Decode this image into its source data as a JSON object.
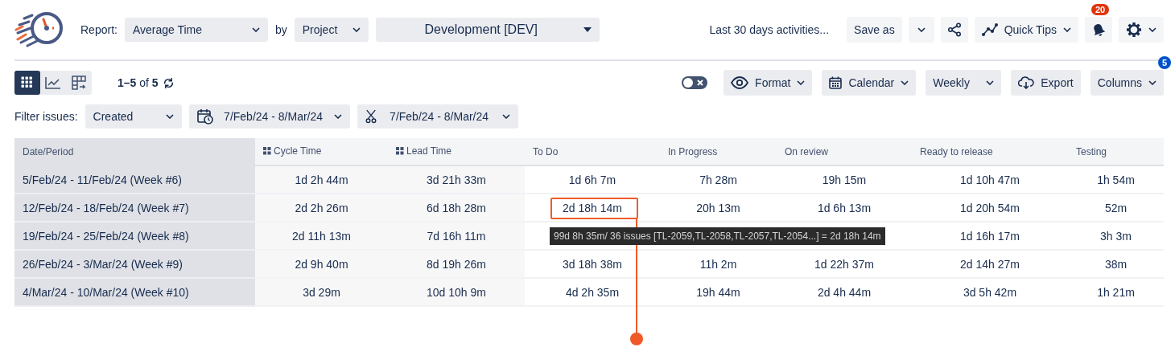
{
  "header": {
    "report_label": "Report:",
    "report": "Average Time",
    "by_label": "by",
    "group": "Project",
    "project": "Development [DEV]",
    "saved_filter": "Last 30 days activities...",
    "save_as": "Save as",
    "quick_tips": "Quick Tips",
    "notifications_count": "20"
  },
  "toolbar": {
    "views": [
      {
        "kind": "grid",
        "selected": true
      },
      {
        "kind": "chart",
        "selected": false
      },
      {
        "kind": "pivot",
        "selected": false
      }
    ],
    "pagination": "**1–5** of **5**",
    "toggle": {
      "on": false
    },
    "format": "Format",
    "calendar": "Calendar",
    "interval": "Weekly",
    "export": "Export",
    "columns": "Columns",
    "columns_count": "5"
  },
  "filters": {
    "label": "Filter issues:",
    "field": "Created",
    "date_range": "7/Feb/24 - 8/Mar/24",
    "resolved_range": "7/Feb/24 - 8/Mar/24"
  },
  "table": {
    "columns": [
      {
        "label": "Date/Period",
        "kind": "period"
      },
      {
        "label": "Cycle Time",
        "kind": "metric"
      },
      {
        "label": "Lead Time",
        "kind": "metric"
      },
      {
        "label": "To Do",
        "kind": "status"
      },
      {
        "label": "In Progress",
        "kind": "status"
      },
      {
        "label": "On review",
        "kind": "status"
      },
      {
        "label": "Ready to release",
        "kind": "status"
      },
      {
        "label": "Testing",
        "kind": "status"
      }
    ],
    "rows": [
      {
        "cells": [
          {
            "text": "5/Feb/24 - 11/Feb/24 (Week #6)",
            "highlighted": false
          },
          {
            "text": "1d 2h 44m",
            "highlighted": false
          },
          {
            "text": "3d 21h 33m",
            "highlighted": false
          },
          {
            "text": "1d 6h 7m",
            "highlighted": false
          },
          {
            "text": "7h 28m",
            "highlighted": false
          },
          {
            "text": "19h 15m",
            "highlighted": false
          },
          {
            "text": "1d 10h 47m",
            "highlighted": false
          },
          {
            "text": "1h 54m",
            "highlighted": false
          }
        ]
      },
      {
        "cells": [
          {
            "text": "12/Feb/24 - 18/Feb/24 (Week #7)",
            "highlighted": false
          },
          {
            "text": "2d 2h 26m",
            "highlighted": false
          },
          {
            "text": "6d 18h 28m",
            "highlighted": false
          },
          {
            "text": "2d 18h 14m",
            "highlighted": true
          },
          {
            "text": "20h 13m",
            "highlighted": false
          },
          {
            "text": "1d 6h 13m",
            "highlighted": false
          },
          {
            "text": "1d 20h 54m",
            "highlighted": false
          },
          {
            "text": "52m",
            "highlighted": false
          }
        ]
      },
      {
        "cells": [
          {
            "text": "19/Feb/24 - 25/Feb/24 (Week #8)",
            "highlighted": false
          },
          {
            "text": "2d 11h 13m",
            "highlighted": false
          },
          {
            "text": "7d 16h 11m",
            "highlighted": false
          },
          {
            "highlighted": false
          },
          {
            "highlighted": false
          },
          {
            "highlighted": false
          },
          {
            "text": "1d 16h 17m",
            "highlighted": false
          },
          {
            "text": "3h 3m",
            "highlighted": false
          }
        ]
      },
      {
        "cells": [
          {
            "text": "26/Feb/24 - 3/Mar/24 (Week #9)",
            "highlighted": false
          },
          {
            "text": "2d 9h 40m",
            "highlighted": false
          },
          {
            "text": "8d 19h 26m",
            "highlighted": false
          },
          {
            "text": "3d 18h 38m",
            "highlighted": false
          },
          {
            "text": "11h 2m",
            "highlighted": false
          },
          {
            "text": "1d 22h 37m",
            "highlighted": false
          },
          {
            "text": "2d 14h 27m",
            "highlighted": false
          },
          {
            "text": "38m",
            "highlighted": false
          }
        ]
      },
      {
        "cells": [
          {
            "text": "4/Mar/24 - 10/Mar/24 (Week #10)",
            "highlighted": false
          },
          {
            "text": "3d 29m",
            "highlighted": false
          },
          {
            "text": "10d 10h 9m",
            "highlighted": false
          },
          {
            "text": "4d 2h 35m",
            "highlighted": false
          },
          {
            "text": "19h 44m",
            "highlighted": false
          },
          {
            "text": "2d 4h 44m",
            "highlighted": false
          },
          {
            "text": "3d 5h 42m",
            "highlighted": false
          },
          {
            "text": "1h 21m",
            "highlighted": false
          }
        ]
      }
    ]
  },
  "tooltip": "99d 8h 35m/ 36 issues [TL-2059,TL-2058,TL-2057,TL-2054...] = 2d 18h 14m"
}
